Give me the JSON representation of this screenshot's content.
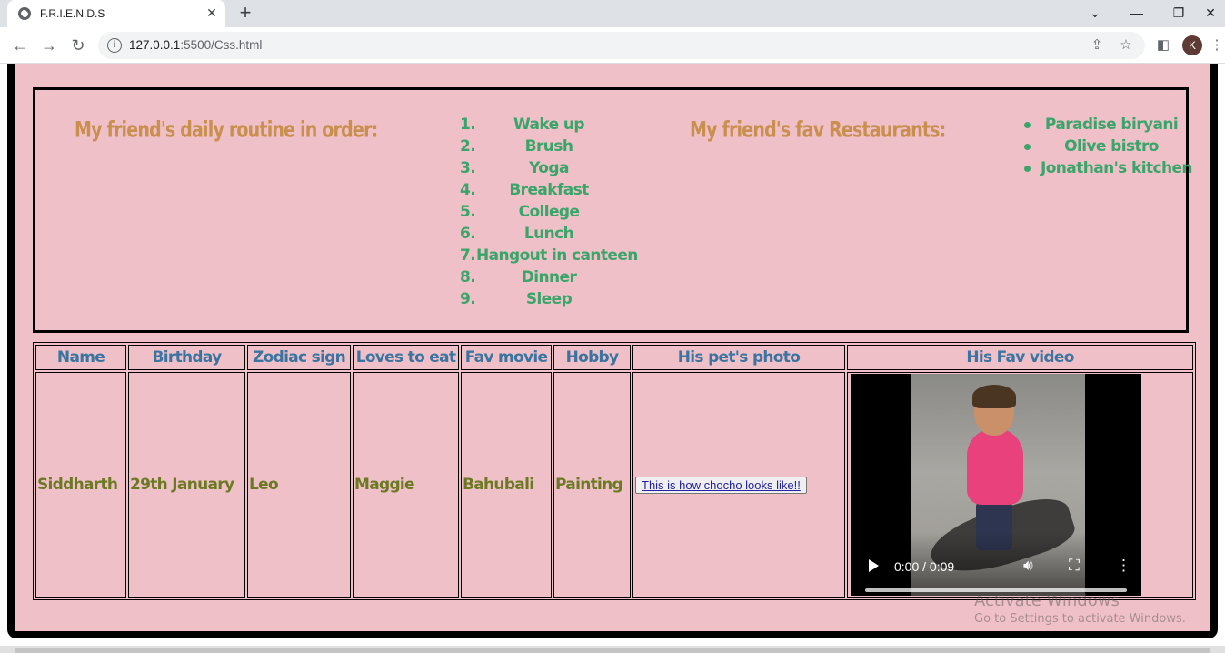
{
  "browser": {
    "tab_title": "F.R.I.E.N.D.S",
    "url_host": "127.0.0.1",
    "url_path": ":5500/Css.html",
    "avatar_letter": "K"
  },
  "routine": {
    "heading": "My friend's daily routine in order:",
    "items": [
      {
        "num": "1.",
        "text": "Wake up"
      },
      {
        "num": "2.",
        "text": "Brush"
      },
      {
        "num": "3.",
        "text": "Yoga"
      },
      {
        "num": "4.",
        "text": "Breakfast"
      },
      {
        "num": "5.",
        "text": "College"
      },
      {
        "num": "6.",
        "text": "Lunch"
      },
      {
        "num": "7.",
        "text": "Hangout in canteen"
      },
      {
        "num": "8.",
        "text": "Dinner"
      },
      {
        "num": "9.",
        "text": "Sleep"
      }
    ]
  },
  "restaurants": {
    "heading": "My friend's fav Restaurants:",
    "items": [
      "Paradise biryani",
      "Olive bistro",
      "Jonathan's kitchen"
    ]
  },
  "table": {
    "headers": [
      "Name",
      "Birthday",
      "Zodiac sign",
      "Loves to eat",
      "Fav movie",
      "Hobby",
      "His pet's photo",
      "His Fav video"
    ],
    "row": {
      "name": "Siddharth",
      "birthday": "29th January",
      "zodiac": "Leo",
      "loves_to_eat": "Maggie",
      "fav_movie": "Bahubali",
      "hobby": "Painting",
      "pet_photo_link": "This is how chocho looks like!!",
      "video_time": "0:00 / 0:09"
    }
  },
  "watermark": {
    "line1": "Activate Windows",
    "line2": "Go to Settings to activate Windows."
  },
  "colors": {
    "page_bg": "#f0c0c8",
    "heading": "#c88f4e",
    "list_text": "#3aa56a",
    "table_header": "#3a74a0",
    "table_cell": "#6b7a22"
  }
}
